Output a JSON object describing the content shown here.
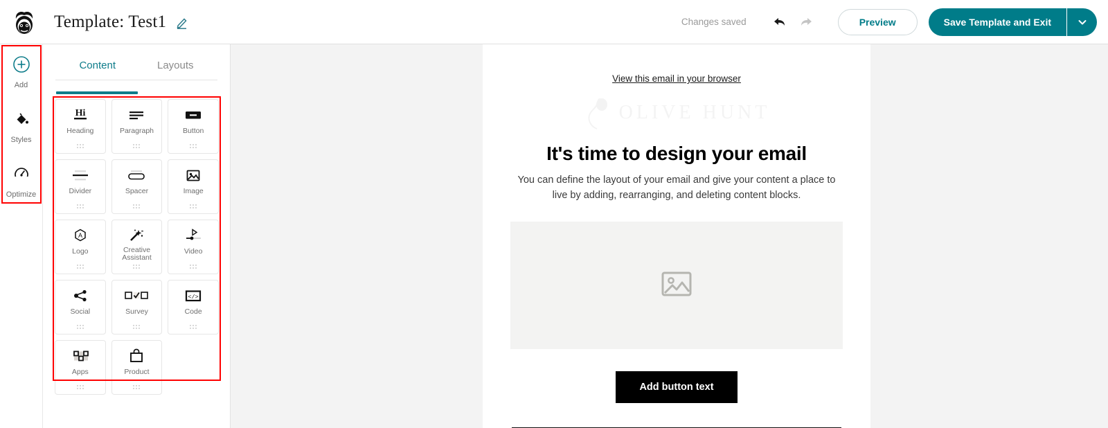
{
  "topbar": {
    "logo_icon": "mailchimp-monkey-logo",
    "title": "Template: Test1",
    "edit_icon": "pencil-edit-icon",
    "saved_status": "Changes saved",
    "undo_icon": "undo-arrow-icon",
    "redo_icon": "redo-arrow-icon",
    "preview_label": "Preview",
    "save_label": "Save Template and Exit",
    "save_caret_icon": "chevron-down-icon",
    "accent_color": "#007c89",
    "muted_color": "#9a9a9a"
  },
  "rail": {
    "highlight_color": "#ff0000",
    "items": [
      {
        "label": "Add",
        "icon": "plus-circle-icon",
        "active": true
      },
      {
        "label": "Styles",
        "icon": "paint-bucket-icon",
        "active": false
      },
      {
        "label": "Optimize",
        "icon": "gauge-optimize-icon",
        "active": false
      }
    ]
  },
  "panel": {
    "tabs": [
      {
        "label": "Content",
        "active": true
      },
      {
        "label": "Layouts",
        "active": false
      }
    ],
    "highlight_color": "#ff0000",
    "grip_icon": "drag-handle-dots-icon",
    "blocks": [
      {
        "label": "Heading",
        "icon": "heading-hi-icon"
      },
      {
        "label": "Paragraph",
        "icon": "paragraph-lines-icon"
      },
      {
        "label": "Button",
        "icon": "button-rect-icon"
      },
      {
        "label": "Divider",
        "icon": "divider-icon"
      },
      {
        "label": "Spacer",
        "icon": "spacer-icon"
      },
      {
        "label": "Image",
        "icon": "image-photo-icon"
      },
      {
        "label": "Logo",
        "icon": "logo-hexagon-icon"
      },
      {
        "label": "Creative Assistant",
        "icon": "magic-wand-sparkle-icon"
      },
      {
        "label": "Video",
        "icon": "video-play-slider-icon"
      },
      {
        "label": "Social",
        "icon": "social-share-icon"
      },
      {
        "label": "Survey",
        "icon": "survey-checkbox-icon"
      },
      {
        "label": "Code",
        "icon": "code-brackets-icon"
      },
      {
        "label": "Apps",
        "icon": "apps-grid-icon"
      },
      {
        "label": "Product",
        "icon": "product-bag-icon"
      }
    ]
  },
  "email": {
    "view_in_browser": "View this email in your browser",
    "ghost_logo_text": "OLIVE HUNT",
    "ghost_logo_icon": "placeholder-logo-icon",
    "heading": "It's time to design your email",
    "body": "You can define the layout of your email and give your content a place to live by adding, rearranging, and deleting content blocks.",
    "image_placeholder_icon": "image-placeholder-icon",
    "cta_label": "Add button text",
    "cta_bg": "#000000",
    "canvas_bg": "#f3f3f3"
  }
}
